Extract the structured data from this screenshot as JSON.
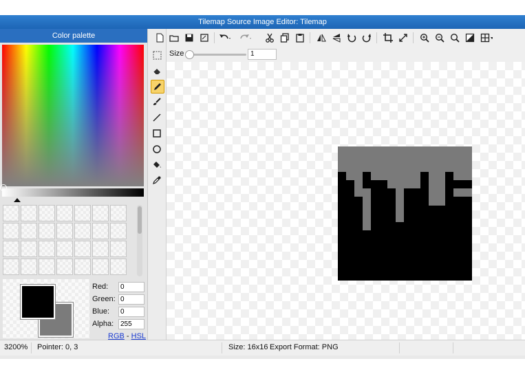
{
  "window": {
    "title": "Tilemap Source Image Editor: Tilemap"
  },
  "palette": {
    "header": "Color palette",
    "red_label": "Red:",
    "red_value": "0",
    "green_label": "Green:",
    "green_value": "0",
    "blue_label": "Blue:",
    "blue_value": "0",
    "alpha_label": "Alpha:",
    "alpha_value": "255",
    "rgb_link": "RGB",
    "link_sep": "-",
    "hsl_link": "HSL",
    "foreground_color": "#000000",
    "background_color": "#7b7b7b"
  },
  "sizebar": {
    "label": "Size",
    "value": "1"
  },
  "status": {
    "zoom": "3200%",
    "pointer": "Pointer: 0, 3",
    "size": "Size: 16x16",
    "format": "Export Format: PNG"
  },
  "colors": {
    "accent": "#2a6fc0",
    "active_tool": "#f7d36a",
    "image_gray": "#7a7a7a"
  }
}
